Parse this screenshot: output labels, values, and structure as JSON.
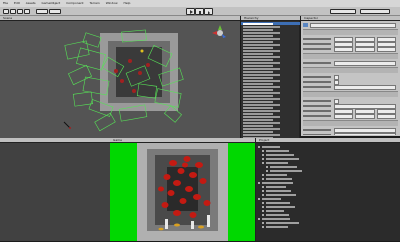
{
  "menu": [
    "File",
    "Edit",
    "Assets",
    "GameObject",
    "Component",
    "Terrain",
    "Window",
    "Help"
  ],
  "toolbar": {
    "play_icon": "play-icon",
    "pause_icon": "pause-icon",
    "step_icon": "step-icon",
    "layers_label": "Layers",
    "layout_label": "Layout"
  },
  "scene": {
    "tab": "Scene",
    "icons": [
      "hand-icon",
      "move-icon",
      "rotate-icon",
      "scale-icon"
    ]
  },
  "hierarchy": {
    "tab": "Hierarchy",
    "item_count": 58
  },
  "inspector": {
    "tab": "Inspector"
  },
  "project": {
    "tab": "Project"
  },
  "game": {
    "tab": "Game"
  },
  "colors": {
    "green": "#00d800",
    "select": "#3d6fb6",
    "chrome": "#c2c2c2"
  }
}
